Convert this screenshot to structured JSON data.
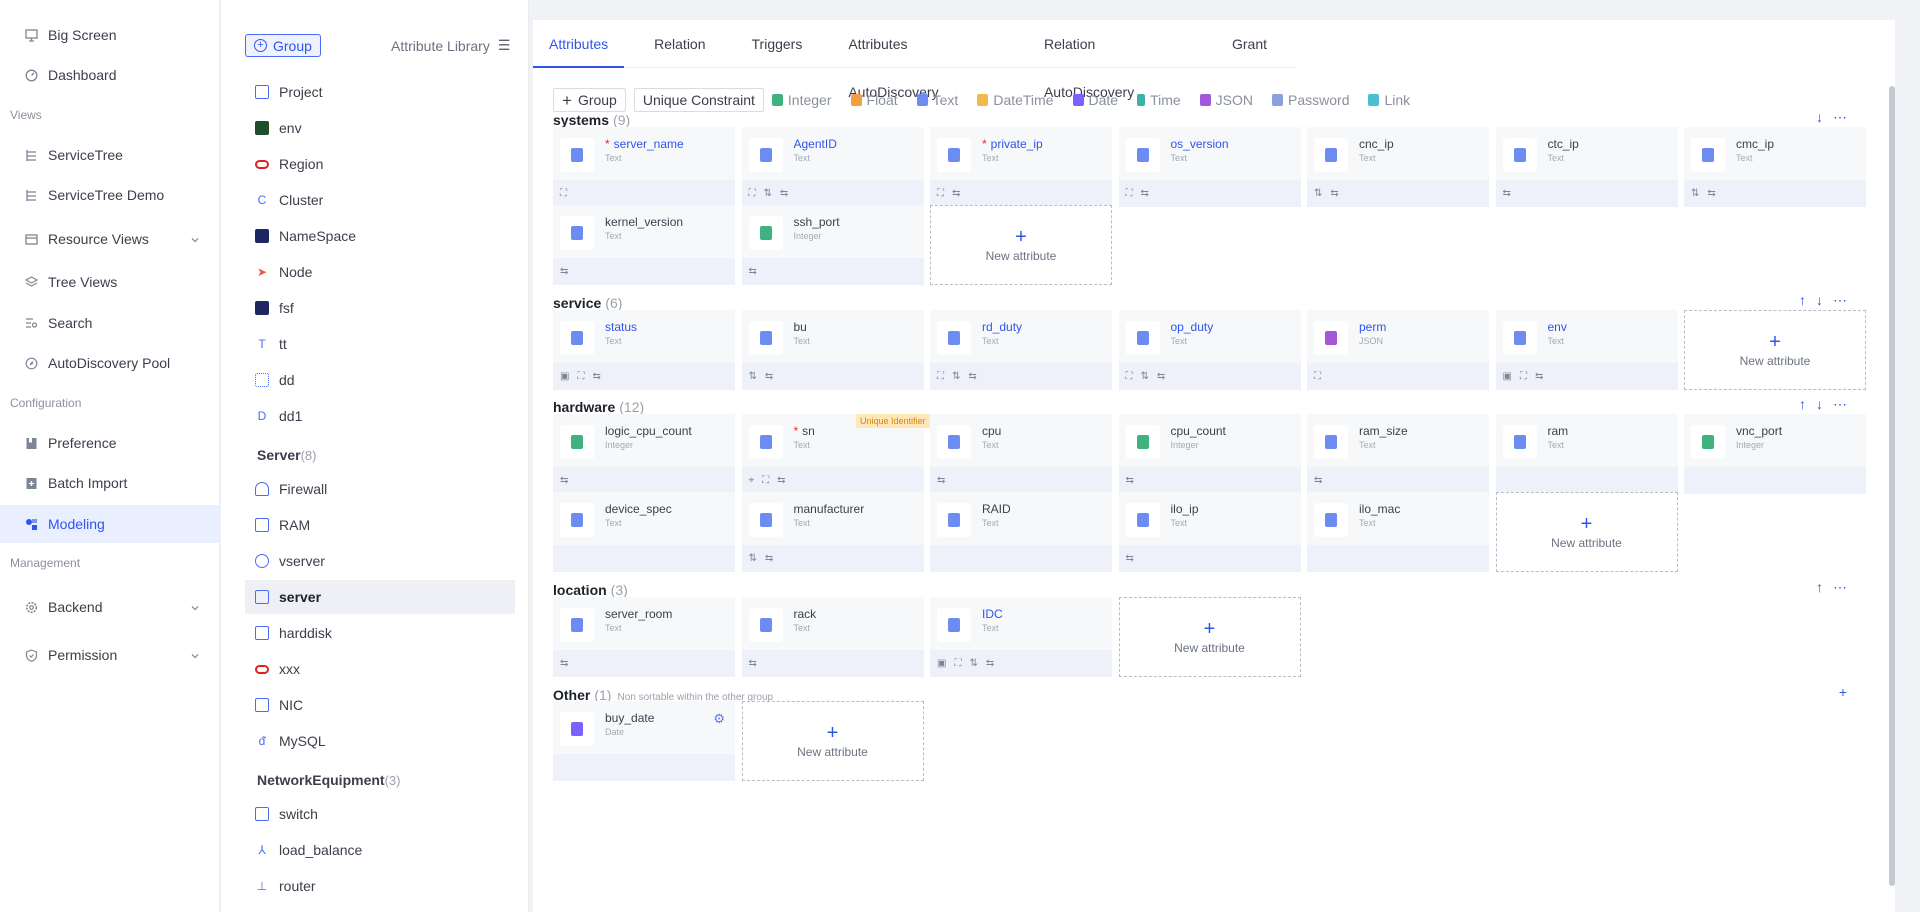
{
  "nav": {
    "items": [
      {
        "label": "Big Screen",
        "icon": "monitor-icon"
      },
      {
        "label": "Dashboard",
        "icon": "gauge-icon"
      },
      {
        "label": "ServiceTree",
        "icon": "tree-icon"
      },
      {
        "label": "ServiceTree Demo",
        "icon": "tree-icon"
      },
      {
        "label": "Resource Views",
        "icon": "table-icon"
      },
      {
        "label": "Tree Views",
        "icon": "layers-icon"
      },
      {
        "label": "Search",
        "icon": "search-icon"
      },
      {
        "label": "AutoDiscovery Pool",
        "icon": "compass-icon"
      },
      {
        "label": "Preference",
        "icon": "bookmark-icon"
      },
      {
        "label": "Batch Import",
        "icon": "import-icon"
      },
      {
        "label": "Modeling",
        "icon": "model-icon"
      },
      {
        "label": "Backend",
        "icon": "gear-icon"
      },
      {
        "label": "Permission",
        "icon": "shield-icon"
      }
    ],
    "sections": {
      "views": "Views",
      "configuration": "Configuration",
      "management": "Management"
    }
  },
  "panel": {
    "group_button": "Group",
    "library_label": "Attribute Library",
    "ungrouped": [
      {
        "label": "Project"
      },
      {
        "label": "env"
      },
      {
        "label": "Region"
      },
      {
        "label": "Cluster"
      },
      {
        "label": "NameSpace"
      },
      {
        "label": "Node"
      },
      {
        "label": "fsf"
      },
      {
        "label": "tt"
      },
      {
        "label": "dd"
      },
      {
        "label": "dd1"
      }
    ],
    "server_group": {
      "name": "Server",
      "count": "(8)"
    },
    "server_items": [
      {
        "label": "Firewall"
      },
      {
        "label": "RAM"
      },
      {
        "label": "vserver"
      },
      {
        "label": "server"
      },
      {
        "label": "harddisk"
      },
      {
        "label": "xxx"
      },
      {
        "label": "NIC"
      },
      {
        "label": "MySQL"
      }
    ],
    "net_group": {
      "name": "NetworkEquipment",
      "count": "(3)"
    },
    "net_items": [
      {
        "label": "switch"
      },
      {
        "label": "load_balance"
      },
      {
        "label": "router"
      }
    ]
  },
  "tabs": [
    "Attributes",
    "Relation",
    "Triggers",
    "Attributes AutoDiscovery",
    "Relation AutoDiscovery",
    "Grant"
  ],
  "toolbar": {
    "group": "Group",
    "unique": "Unique Constraint",
    "types": [
      "Integer",
      "Float",
      "Text",
      "DateTime",
      "Date",
      "Time",
      "JSON",
      "Password",
      "Link"
    ]
  },
  "colors": {
    "accent": "#2f54eb",
    "text_type": "#6c8cf2",
    "integer_type": "#3fb27f",
    "json_type": "#a259d9",
    "date_type": "#7b61ff",
    "required": "#f5222d",
    "badge": "#ffe7ba"
  },
  "new_attribute": "New attribute",
  "sections": {
    "systems": {
      "name": "systems",
      "count": "(9)",
      "attrs": [
        {
          "name": "server_name",
          "type": "Text",
          "req": "*"
        },
        {
          "name": "AgentID",
          "type": "Text"
        },
        {
          "name": "private_ip",
          "type": "Text",
          "req": "*"
        },
        {
          "name": "os_version",
          "type": "Text"
        },
        {
          "name": "cnc_ip",
          "type": "Text"
        },
        {
          "name": "ctc_ip",
          "type": "Text"
        },
        {
          "name": "cmc_ip",
          "type": "Text"
        },
        {
          "name": "kernel_version",
          "type": "Text"
        },
        {
          "name": "ssh_port",
          "type": "Integer"
        }
      ]
    },
    "service": {
      "name": "service",
      "count": "(6)",
      "attrs": [
        {
          "name": "status",
          "type": "Text"
        },
        {
          "name": "bu",
          "type": "Text"
        },
        {
          "name": "rd_duty",
          "type": "Text"
        },
        {
          "name": "op_duty",
          "type": "Text"
        },
        {
          "name": "perm",
          "type": "JSON"
        },
        {
          "name": "env",
          "type": "Text"
        }
      ]
    },
    "hardware": {
      "name": "hardware",
      "count": "(12)",
      "badge": "Unique Identifier",
      "attrs": [
        {
          "name": "logic_cpu_count",
          "type": "Integer"
        },
        {
          "name": "sn",
          "type": "Text",
          "req": "*"
        },
        {
          "name": "cpu",
          "type": "Text"
        },
        {
          "name": "cpu_count",
          "type": "Integer"
        },
        {
          "name": "ram_size",
          "type": "Text"
        },
        {
          "name": "ram",
          "type": "Text"
        },
        {
          "name": "vnc_port",
          "type": "Integer"
        },
        {
          "name": "device_spec",
          "type": "Text"
        },
        {
          "name": "manufacturer",
          "type": "Text"
        },
        {
          "name": "RAID",
          "type": "Text"
        },
        {
          "name": "ilo_ip",
          "type": "Text"
        },
        {
          "name": "ilo_mac",
          "type": "Text"
        }
      ]
    },
    "location": {
      "name": "location",
      "count": "(3)",
      "attrs": [
        {
          "name": "server_room",
          "type": "Text"
        },
        {
          "name": "rack",
          "type": "Text"
        },
        {
          "name": "IDC",
          "type": "Text"
        }
      ]
    },
    "other": {
      "name": "Other",
      "count": "(1)",
      "note": "Non sortable within the other group",
      "attrs": [
        {
          "name": "buy_date",
          "type": "Date"
        }
      ]
    }
  }
}
